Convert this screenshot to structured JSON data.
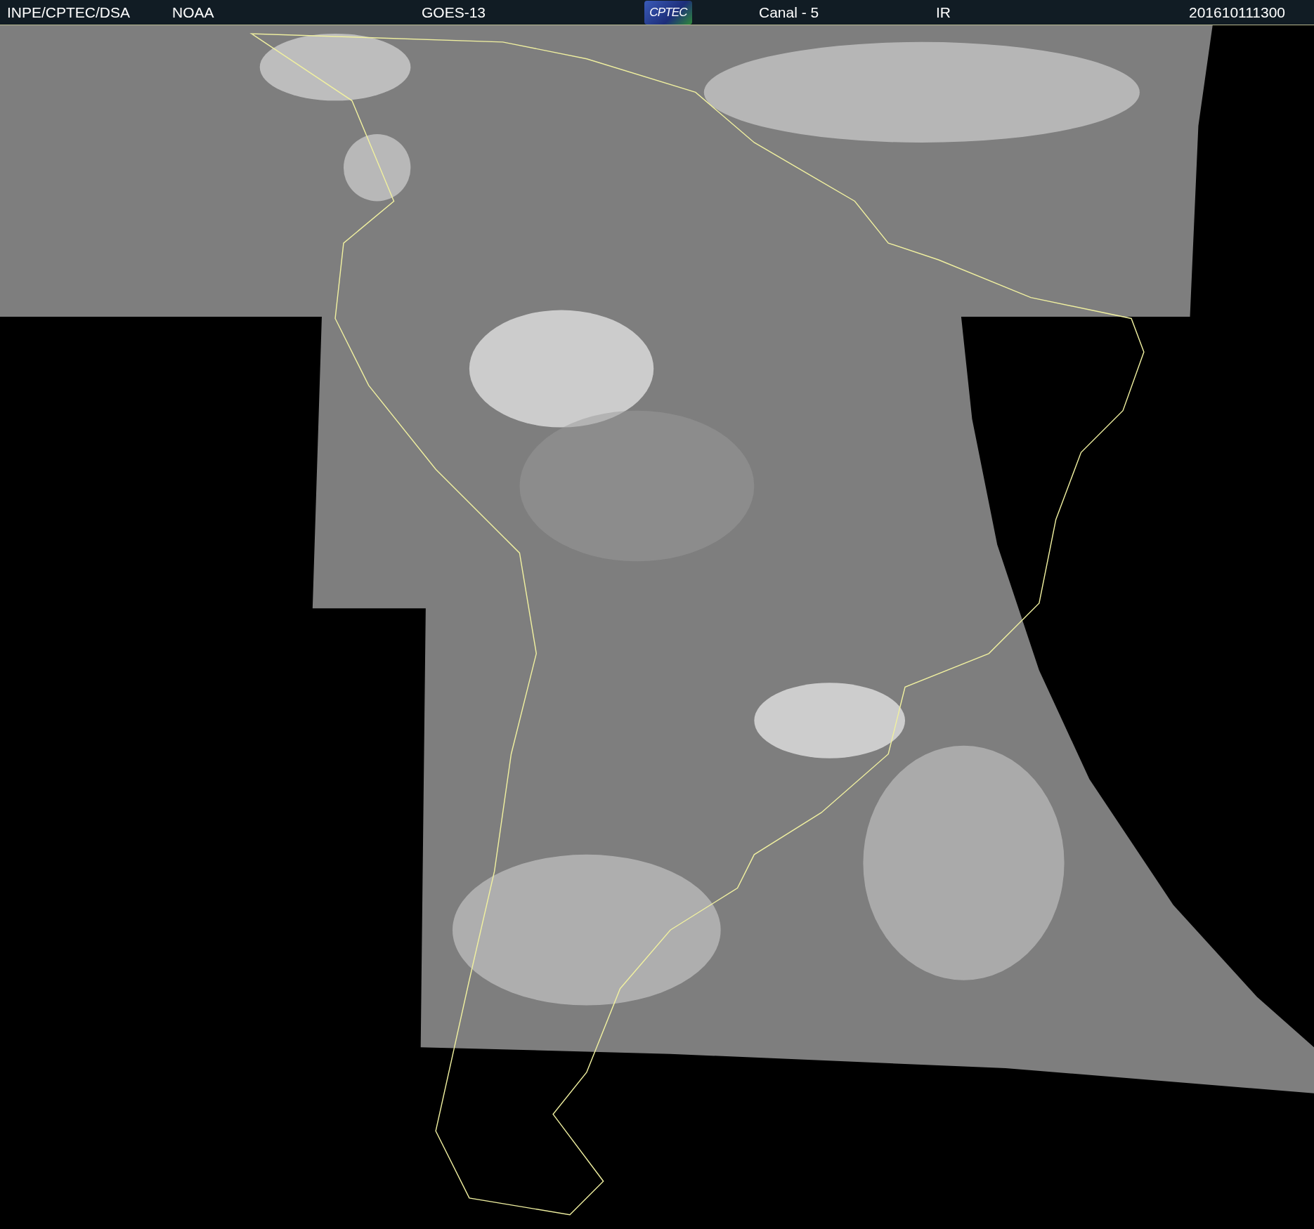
{
  "header": {
    "source": "INPE/CPTEC/DSA",
    "agency": "NOAA",
    "satellite": "GOES-13",
    "logo": "CPTEC",
    "channel": "Canal - 5",
    "band": "IR",
    "timestamp": "201610111300"
  }
}
